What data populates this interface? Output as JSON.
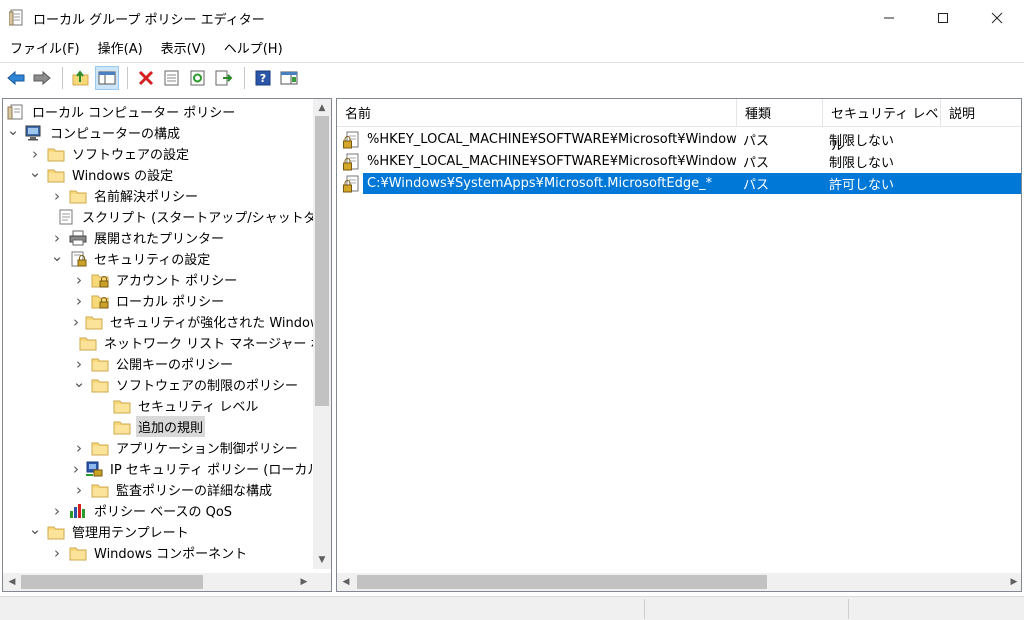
{
  "window": {
    "title": "ローカル グループ ポリシー エディター",
    "minimize": "—",
    "maximize": "☐",
    "close": "✕"
  },
  "menu": [
    "ファイル(F)",
    "操作(A)",
    "表示(V)",
    "ヘルプ(H)"
  ],
  "toolbar": {
    "icons": [
      "back-icon",
      "forward-icon",
      "up-folder-icon",
      "show-hide-tree-icon",
      "delete-icon",
      "properties-icon",
      "refresh-icon",
      "export-list-icon",
      "help-icon",
      "show-hide-action-pane-icon"
    ],
    "pressed": "show-hide-tree-icon"
  },
  "colors": {
    "selection": "#0078d7",
    "tree_selection": "#d9d9d9",
    "folder": "#f7d97a"
  },
  "tree": [
    {
      "label": "ローカル コンピューター ポリシー",
      "level": 0,
      "chevron": "",
      "icon": "policy-icon"
    },
    {
      "label": "コンピューターの構成",
      "level": 0,
      "chevron": "v",
      "icon": "computer-icon"
    },
    {
      "label": "ソフトウェアの設定",
      "level": 1,
      "chevron": ">",
      "icon": "folder-icon"
    },
    {
      "label": "Windows の設定",
      "level": 1,
      "chevron": "v",
      "icon": "folder-icon"
    },
    {
      "label": "名前解決ポリシー",
      "level": 2,
      "chevron": ">",
      "icon": "folder-icon"
    },
    {
      "label": "スクリプト (スタートアップ/シャットダウン)",
      "level": 2,
      "chevron": "",
      "icon": "script-icon"
    },
    {
      "label": "展開されたプリンター",
      "level": 2,
      "chevron": ">",
      "icon": "printer-icon"
    },
    {
      "label": "セキュリティの設定",
      "level": 2,
      "chevron": "v",
      "icon": "security-icon"
    },
    {
      "label": "アカウント ポリシー",
      "level": 3,
      "chevron": ">",
      "icon": "folder-lock-icon"
    },
    {
      "label": "ローカル ポリシー",
      "level": 3,
      "chevron": ">",
      "icon": "folder-lock-icon"
    },
    {
      "label": "セキュリティが強化された Windows",
      "level": 3,
      "chevron": ">",
      "icon": "folder-icon"
    },
    {
      "label": "ネットワーク リスト マネージャー ポリシ",
      "level": 3,
      "chevron": "",
      "icon": "folder-icon"
    },
    {
      "label": "公開キーのポリシー",
      "level": 3,
      "chevron": ">",
      "icon": "folder-icon"
    },
    {
      "label": "ソフトウェアの制限のポリシー",
      "level": 3,
      "chevron": "v",
      "icon": "folder-icon"
    },
    {
      "label": "セキュリティ レベル",
      "level": 4,
      "chevron": "",
      "icon": "folder-icon"
    },
    {
      "label": "追加の規則",
      "level": 4,
      "chevron": "",
      "icon": "folder-icon",
      "selected": true
    },
    {
      "label": "アプリケーション制御ポリシー",
      "level": 3,
      "chevron": ">",
      "icon": "folder-icon"
    },
    {
      "label": "IP セキュリティ ポリシー (ローカル コン",
      "level": 3,
      "chevron": ">",
      "icon": "ipsec-icon"
    },
    {
      "label": "監査ポリシーの詳細な構成",
      "level": 3,
      "chevron": ">",
      "icon": "folder-icon"
    },
    {
      "label": "ポリシー ベースの QoS",
      "level": 2,
      "chevron": ">",
      "icon": "chart-icon"
    },
    {
      "label": "管理用テンプレート",
      "level": 1,
      "chevron": "v",
      "icon": "folder-icon"
    },
    {
      "label": "Windows コンポーネント",
      "level": 2,
      "chevron": ">",
      "icon": "folder-icon"
    }
  ],
  "list": {
    "columns": [
      "名前",
      "種類",
      "セキュリティ レベル",
      "説明"
    ],
    "rows": [
      {
        "name": "%HKEY_LOCAL_MACHINE¥SOFTWARE¥Microsoft¥Windows...",
        "type": "パス",
        "level": "制限しない",
        "desc": ""
      },
      {
        "name": "%HKEY_LOCAL_MACHINE¥SOFTWARE¥Microsoft¥Windows...",
        "type": "パス",
        "level": "制限しない",
        "desc": ""
      },
      {
        "name": "C:¥Windows¥SystemApps¥Microsoft.MicrosoftEdge_*",
        "type": "パス",
        "level": "許可しない",
        "desc": "",
        "selected": true
      }
    ]
  }
}
